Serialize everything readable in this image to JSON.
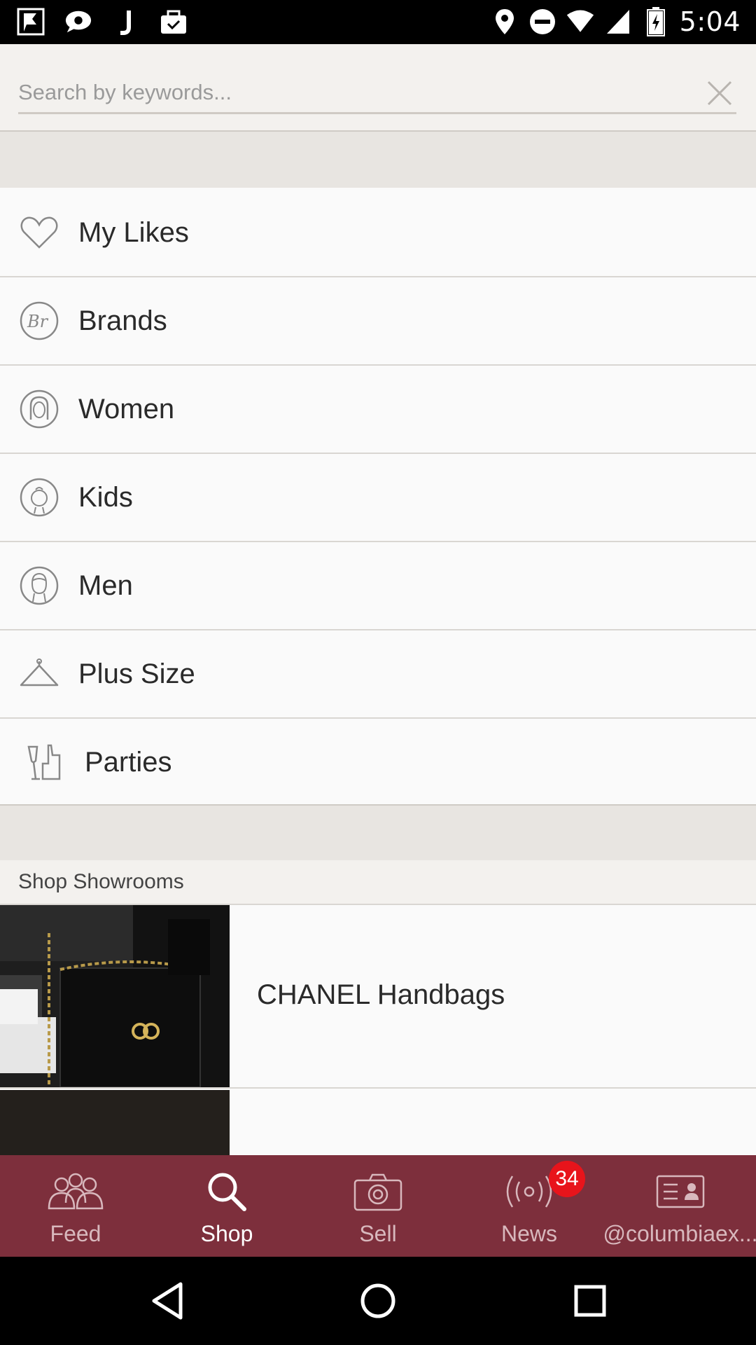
{
  "status_bar": {
    "time": "5:04",
    "left_icons": [
      "notification-flag-icon",
      "chat-bubble-icon",
      "j-app-icon",
      "briefcase-check-icon"
    ],
    "right_icons": [
      "location-pin-icon",
      "do-not-disturb-icon",
      "wifi-icon",
      "cell-signal-icon",
      "battery-charging-icon"
    ]
  },
  "search": {
    "placeholder": "Search by keywords...",
    "value": "",
    "clear_icon": "close-icon"
  },
  "menu": {
    "items": [
      {
        "label": "My Likes",
        "icon": "heart-icon"
      },
      {
        "label": "Brands",
        "icon": "brands-icon"
      },
      {
        "label": "Women",
        "icon": "woman-face-icon"
      },
      {
        "label": "Kids",
        "icon": "kid-face-icon"
      },
      {
        "label": "Men",
        "icon": "man-face-icon"
      },
      {
        "label": "Plus Size",
        "icon": "hanger-icon"
      },
      {
        "label": "Parties",
        "icon": "party-glass-icon"
      }
    ]
  },
  "showrooms": {
    "header": "Shop Showrooms",
    "items": [
      {
        "title": "CHANEL Handbags"
      },
      {
        "title": ""
      }
    ]
  },
  "tab_bar": {
    "active": "Shop",
    "tabs": [
      {
        "label": "Feed",
        "icon": "people-icon"
      },
      {
        "label": "Shop",
        "icon": "search-icon"
      },
      {
        "label": "Sell",
        "icon": "camera-icon"
      },
      {
        "label": "News",
        "icon": "broadcast-icon",
        "badge": "34"
      },
      {
        "label": "@columbiaex...",
        "icon": "profile-card-icon"
      }
    ]
  },
  "nav_bar": {
    "buttons": [
      "back-icon",
      "home-icon",
      "recents-icon"
    ]
  },
  "colors": {
    "tab_bar_bg": "#7d2f3c",
    "badge": "#e8141b",
    "page_bg": "#fafafa",
    "section_bg": "#e8e5e1"
  }
}
